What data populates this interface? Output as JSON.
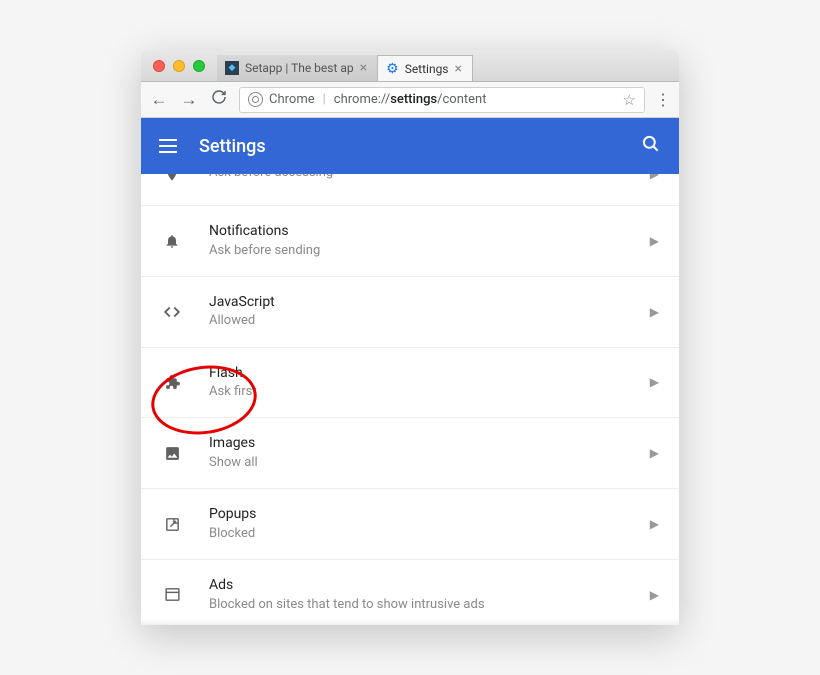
{
  "window": {
    "tabs": [
      {
        "title": "Setapp | The best ap",
        "active": false
      },
      {
        "title": "Settings",
        "active": true
      }
    ]
  },
  "address": {
    "scheme_label": "Chrome",
    "url_prefix": "chrome://",
    "url_bold": "settings",
    "url_suffix": "/content"
  },
  "header": {
    "title": "Settings"
  },
  "items": [
    {
      "id": "location",
      "title": "",
      "sub": "Ask before accessing"
    },
    {
      "id": "notifications",
      "title": "Notifications",
      "sub": "Ask before sending"
    },
    {
      "id": "javascript",
      "title": "JavaScript",
      "sub": "Allowed"
    },
    {
      "id": "flash",
      "title": "Flash",
      "sub": "Ask first"
    },
    {
      "id": "images",
      "title": "Images",
      "sub": "Show all"
    },
    {
      "id": "popups",
      "title": "Popups",
      "sub": "Blocked"
    },
    {
      "id": "ads",
      "title": "Ads",
      "sub": "Blocked on sites that tend to show intrusive ads"
    }
  ]
}
